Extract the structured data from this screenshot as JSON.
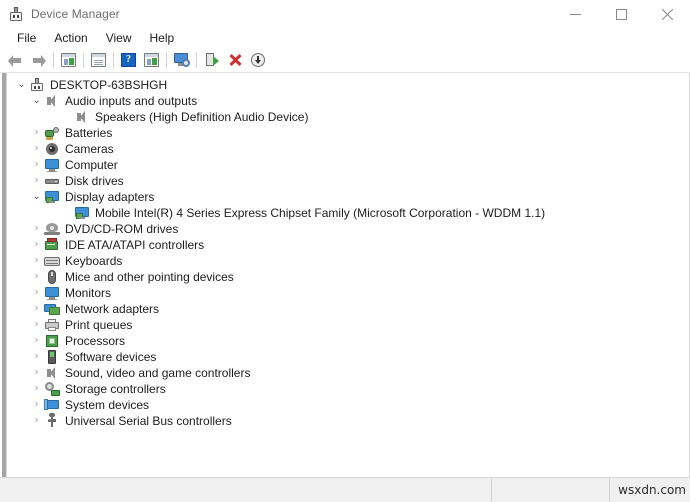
{
  "window": {
    "title": "Device Manager",
    "app_icon": "device-manager-icon"
  },
  "window_controls": {
    "minimize": "minimize-icon",
    "maximize": "maximize-icon",
    "close": "close-icon"
  },
  "menu": {
    "items": [
      {
        "label": "File"
      },
      {
        "label": "Action"
      },
      {
        "label": "View"
      },
      {
        "label": "Help"
      }
    ]
  },
  "toolbar": {
    "buttons": [
      {
        "name": "back-button",
        "icon": "back-arrow-icon",
        "tooltip": "Back"
      },
      {
        "name": "forward-button",
        "icon": "forward-arrow-icon",
        "tooltip": "Forward"
      },
      {
        "name": "properties-button",
        "icon": "properties-window-icon",
        "tooltip": "Properties"
      },
      {
        "name": "update-driver-button",
        "icon": "update-driver-icon",
        "tooltip": "Update driver"
      },
      {
        "name": "help-button",
        "icon": "help-question-icon",
        "tooltip": "Help"
      },
      {
        "name": "show-hidden-button",
        "icon": "show-window-icon",
        "tooltip": "Show hidden devices"
      },
      {
        "name": "scan-hardware-button",
        "icon": "monitor-scan-icon",
        "tooltip": "Scan for hardware changes"
      },
      {
        "name": "uninstall-device-button",
        "icon": "uninstall-device-icon",
        "tooltip": "Uninstall device"
      },
      {
        "name": "disable-device-button",
        "icon": "red-x-icon",
        "tooltip": "Disable device"
      },
      {
        "name": "install-legacy-button",
        "icon": "download-circle-icon",
        "tooltip": "Add legacy hardware"
      }
    ]
  },
  "tree": {
    "nodes": [
      {
        "label": "DESKTOP-63BSHGH",
        "level": 0,
        "state": "expanded",
        "icon": "computer-root-icon"
      },
      {
        "label": "Audio inputs and outputs",
        "level": 1,
        "state": "expanded",
        "icon": "speaker-icon"
      },
      {
        "label": "Speakers (High Definition Audio Device)",
        "level": 2,
        "state": "leaf",
        "icon": "speaker-icon"
      },
      {
        "label": "Batteries",
        "level": 1,
        "state": "collapsed",
        "icon": "battery-icon"
      },
      {
        "label": "Cameras",
        "level": 1,
        "state": "collapsed",
        "icon": "camera-icon"
      },
      {
        "label": "Computer",
        "level": 1,
        "state": "collapsed",
        "icon": "monitor-icon"
      },
      {
        "label": "Disk drives",
        "level": 1,
        "state": "collapsed",
        "icon": "disk-drive-icon"
      },
      {
        "label": "Display adapters",
        "level": 1,
        "state": "expanded",
        "icon": "display-adapter-icon"
      },
      {
        "label": "Mobile Intel(R) 4 Series Express Chipset Family (Microsoft Corporation - WDDM 1.1)",
        "level": 2,
        "state": "leaf",
        "icon": "display-adapter-icon"
      },
      {
        "label": "DVD/CD-ROM drives",
        "level": 1,
        "state": "collapsed",
        "icon": "dvd-drive-icon"
      },
      {
        "label": "IDE ATA/ATAPI controllers",
        "level": 1,
        "state": "collapsed",
        "icon": "ide-controller-icon"
      },
      {
        "label": "Keyboards",
        "level": 1,
        "state": "collapsed",
        "icon": "keyboard-icon"
      },
      {
        "label": "Mice and other pointing devices",
        "level": 1,
        "state": "collapsed",
        "icon": "mouse-icon"
      },
      {
        "label": "Monitors",
        "level": 1,
        "state": "collapsed",
        "icon": "monitor-icon"
      },
      {
        "label": "Network adapters",
        "level": 1,
        "state": "collapsed",
        "icon": "network-adapter-icon"
      },
      {
        "label": "Print queues",
        "level": 1,
        "state": "collapsed",
        "icon": "printer-icon"
      },
      {
        "label": "Processors",
        "level": 1,
        "state": "collapsed",
        "icon": "processor-icon"
      },
      {
        "label": "Software devices",
        "level": 1,
        "state": "collapsed",
        "icon": "software-device-icon"
      },
      {
        "label": "Sound, video and game controllers",
        "level": 1,
        "state": "collapsed",
        "icon": "speaker-icon"
      },
      {
        "label": "Storage controllers",
        "level": 1,
        "state": "collapsed",
        "icon": "storage-controller-icon"
      },
      {
        "label": "System devices",
        "level": 1,
        "state": "collapsed",
        "icon": "system-device-icon"
      },
      {
        "label": "Universal Serial Bus controllers",
        "level": 1,
        "state": "collapsed",
        "icon": "usb-controller-icon"
      }
    ],
    "chevron_expanded": "⌄",
    "chevron_collapsed": "›"
  },
  "statusbar": {
    "main_text": "",
    "mid_text": "",
    "watermark": "wsxdn.com"
  },
  "colors": {
    "accent_blue": "#3d8fd6",
    "green": "#4b9e4b",
    "red": "#d32f2f",
    "help_blue": "#1565c0",
    "text": "#1d1d1d",
    "title_text": "#6d6d6d",
    "chrome_bg": "#f0f0f0"
  }
}
